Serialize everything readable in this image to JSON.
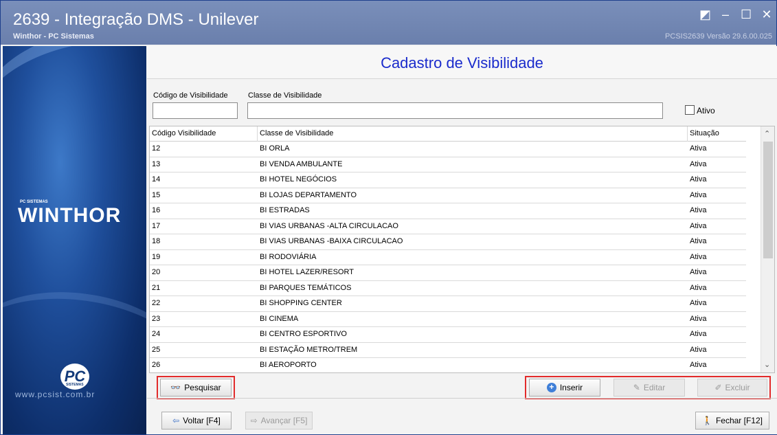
{
  "window": {
    "title": "2639 - Integração DMS - Unilever",
    "subtitle": "Winthor - PC Sistemas",
    "version": "PCSIS2639  Versão 29.6.00.025"
  },
  "brand": {
    "small": "PC SISTEMAS",
    "logo": "WINTHOR",
    "pc": "PC",
    "pc_tag": "SISTEMAS",
    "url": "www.pcsist.com.br"
  },
  "page": {
    "title": "Cadastro de Visibilidade"
  },
  "filters": {
    "codigo_label": "Código de Visibilidade",
    "codigo_value": "",
    "classe_label": "Classe de Visibilidade",
    "classe_value": "",
    "ativo_label": "Ativo",
    "ativo_checked": false
  },
  "grid": {
    "columns": [
      "Código Visibilidade",
      "Classe de Visibilidade",
      "Situação"
    ],
    "rows": [
      {
        "codigo": "12",
        "classe": "BI ORLA",
        "situacao": "Ativa"
      },
      {
        "codigo": "13",
        "classe": "BI VENDA AMBULANTE",
        "situacao": "Ativa"
      },
      {
        "codigo": "14",
        "classe": "BI HOTEL NEGÓCIOS",
        "situacao": "Ativa"
      },
      {
        "codigo": "15",
        "classe": "BI LOJAS DEPARTAMENTO",
        "situacao": "Ativa"
      },
      {
        "codigo": "16",
        "classe": "BI ESTRADAS",
        "situacao": "Ativa"
      },
      {
        "codigo": "17",
        "classe": "BI VIAS URBANAS -ALTA CIRCULACAO",
        "situacao": "Ativa"
      },
      {
        "codigo": "18",
        "classe": "BI VIAS URBANAS -BAIXA CIRCULACAO",
        "situacao": "Ativa"
      },
      {
        "codigo": "19",
        "classe": "BI RODOVIÁRIA",
        "situacao": "Ativa"
      },
      {
        "codigo": "20",
        "classe": "BI HOTEL LAZER/RESORT",
        "situacao": "Ativa"
      },
      {
        "codigo": "21",
        "classe": "BI PARQUES TEMÁTICOS",
        "situacao": "Ativa"
      },
      {
        "codigo": "22",
        "classe": "BI SHOPPING CENTER",
        "situacao": "Ativa"
      },
      {
        "codigo": "23",
        "classe": "BI CINEMA",
        "situacao": "Ativa"
      },
      {
        "codigo": "24",
        "classe": "BI CENTRO ESPORTIVO",
        "situacao": "Ativa"
      },
      {
        "codigo": "25",
        "classe": "BI ESTAÇÃO METRO/TREM",
        "situacao": "Ativa"
      },
      {
        "codigo": "26",
        "classe": "BI AEROPORTO",
        "situacao": "Ativa"
      }
    ]
  },
  "actions": {
    "pesquisar": "Pesquisar",
    "inserir": "Inserir",
    "editar": "Editar",
    "excluir": "Excluir"
  },
  "footer": {
    "voltar": "Voltar [F4]",
    "avancar": "Avançar [F5]",
    "fechar": "Fechar [F12]"
  },
  "colors": {
    "title_blue": "#1a2bcc",
    "highlight_red": "#e22a2a",
    "titlebar": "#7186b4"
  }
}
